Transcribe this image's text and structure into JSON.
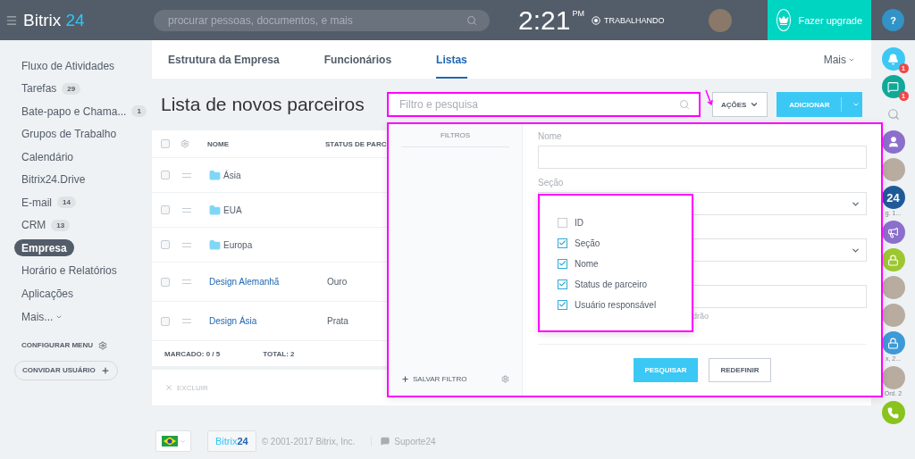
{
  "topbar": {
    "logo": {
      "name": "Bitrix",
      "number": "24"
    },
    "search": {
      "placeholder": "procurar pessoas, documentos, e mais"
    },
    "clock": {
      "time": "2:21",
      "period": "PM"
    },
    "status": "TRABALHANDO",
    "upgrade": "Fazer upgrade",
    "help": "?"
  },
  "sidebar": {
    "items": [
      {
        "label": "Fluxo de Atividades",
        "selected": false
      },
      {
        "label": "Tarefas",
        "count": "29",
        "selected": false
      },
      {
        "label": "Bate-papo e Chama...",
        "count": "1",
        "selected": false
      },
      {
        "label": "Grupos de Trabalho",
        "selected": false
      },
      {
        "label": "Calendário",
        "selected": false
      },
      {
        "label": "Bitrix24.Drive",
        "selected": false
      },
      {
        "label": "E-mail",
        "count": "14",
        "selected": false
      },
      {
        "label": "CRM",
        "count": "13",
        "selected": false
      },
      {
        "label": "Empresa",
        "selected": true
      },
      {
        "label": "Horário e Relatórios",
        "selected": false
      },
      {
        "label": "Aplicações",
        "selected": false
      }
    ],
    "more": "Mais...",
    "configure": "CONFIGURAR MENU",
    "invite": "CONVIDAR USUÁRIO"
  },
  "tabs": [
    {
      "label": "Estrutura da Empresa",
      "selected": false
    },
    {
      "label": "Funcionários",
      "selected": false
    },
    {
      "label": "Listas",
      "selected": true
    }
  ],
  "tabs_more": "Mais",
  "page_title": "Lista de novos parceiros",
  "filter": {
    "placeholder": "Filtro e pesquisa"
  },
  "actions_button": "AÇÕES",
  "add_button": "ADICIONAR",
  "table": {
    "select_all": {
      "checked": false
    },
    "columns": [
      "NOME",
      "STATUS DE PARC"
    ],
    "rows": [
      {
        "kind": "folder",
        "name": "Ásia",
        "status": "",
        "checked": false
      },
      {
        "kind": "folder",
        "name": "EUA",
        "status": "",
        "checked": false
      },
      {
        "kind": "folder",
        "name": "Europa",
        "status": "",
        "checked": false
      },
      {
        "kind": "item",
        "name": "Design Alemanhã",
        "status": "Ouro",
        "checked": false
      },
      {
        "kind": "item",
        "name": "Design Ásia",
        "status": "Prata",
        "checked": false
      }
    ],
    "marked": {
      "label": "MARCADO:",
      "value": "0 / 5"
    },
    "total": {
      "label": "TOTAL:",
      "value": "2"
    },
    "delete": "EXCLUIR"
  },
  "filter_popup": {
    "presets_title": "FILTROS",
    "save_filter": "SALVAR FILTRO",
    "fields": [
      {
        "kind": "input",
        "label": "Nome"
      },
      {
        "kind": "select",
        "label": "Seção"
      },
      {
        "kind": "select"
      },
      {
        "kind": "input"
      }
    ],
    "partial_hint": "drão",
    "search_button": "PESQUISAR",
    "reset_button": "REDEFINIR",
    "field_menu": [
      {
        "label": "ID",
        "checked": false
      },
      {
        "label": "Seção",
        "checked": true
      },
      {
        "label": "Nome",
        "checked": true
      },
      {
        "label": "Status de parceiro",
        "checked": true
      },
      {
        "label": "Usuário responsável",
        "checked": true
      }
    ]
  },
  "rail": [
    {
      "kind": "bell",
      "badge": "1"
    },
    {
      "kind": "chat",
      "badge": "1"
    },
    {
      "kind": "search"
    },
    {
      "kind": "person"
    },
    {
      "kind": "photo"
    },
    {
      "kind": "logo",
      "text": "24",
      "caption": "g. 1..."
    },
    {
      "kind": "megaphone"
    },
    {
      "kind": "lock",
      "color": "#9dc731"
    },
    {
      "kind": "photo"
    },
    {
      "kind": "photo"
    },
    {
      "kind": "lock",
      "color": "#3d9ad6",
      "caption": "x, 2..."
    },
    {
      "kind": "photo",
      "caption": "Ord. 2"
    },
    {
      "kind": "phone"
    }
  ],
  "footer": {
    "brand": {
      "name": "Bitrix",
      "number": "24"
    },
    "copyright": "© 2001-2017 Bitrix, Inc.",
    "support": "Suporte24"
  }
}
